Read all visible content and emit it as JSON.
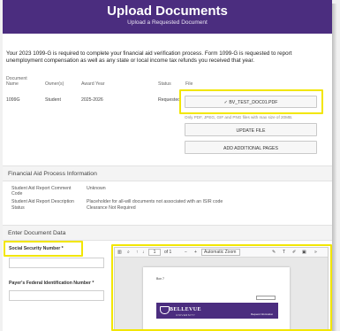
{
  "header": {
    "title": "Upload Documents",
    "subtitle": "Upload a Requested Document"
  },
  "intro_text": "Your 2023 1099-G is required to complete your financial aid verification process. Form 1099-G is requested to report unemployment compensation as well as any state or local income tax refunds you received that year.",
  "documents": {
    "headers": {
      "document_name": "Document Name",
      "owner": "Owner(s)",
      "award_year": "Award Year",
      "status": "Status",
      "file": "File"
    },
    "row": {
      "name": "1099G",
      "owner": "Student",
      "award_year": "2025-2026",
      "status": "Requested"
    },
    "attached_file": "✓ BV_TEST_DOC01.PDF",
    "hint": "Only PDF, JPEG, GIF and PNG files with max size of 20MB.",
    "update_label": "UPDATE FILE",
    "add_pages_label": "ADD ADDITIONAL PAGES"
  },
  "process_info": {
    "title": "Financial Aid Process Information",
    "rows": [
      {
        "key": "Student Aid Report Comment Code",
        "value": "Unknown"
      },
      {
        "key": "Student Aid Report Description",
        "value": "Placeholder for all-will documents not associated with an ISIR code"
      },
      {
        "key": "Status",
        "value": "Clearance Not Required"
      }
    ]
  },
  "document_data": {
    "title": "Enter Document Data",
    "fields": [
      {
        "label": "Social Security Number *",
        "value": ""
      },
      {
        "label": "Payer's Federal Identification Number *",
        "value": ""
      }
    ]
  },
  "viewer": {
    "page_current": "1",
    "page_total": "of 1",
    "zoom": "Automatic Zoom",
    "doc_heading": "Box 7",
    "logo_text": "BELLEVUE",
    "logo_sub": "UNIVERSITY",
    "banner_label": "Request Information"
  },
  "colors": {
    "brand": "#4b2d7f",
    "highlight": "#f2e600"
  }
}
